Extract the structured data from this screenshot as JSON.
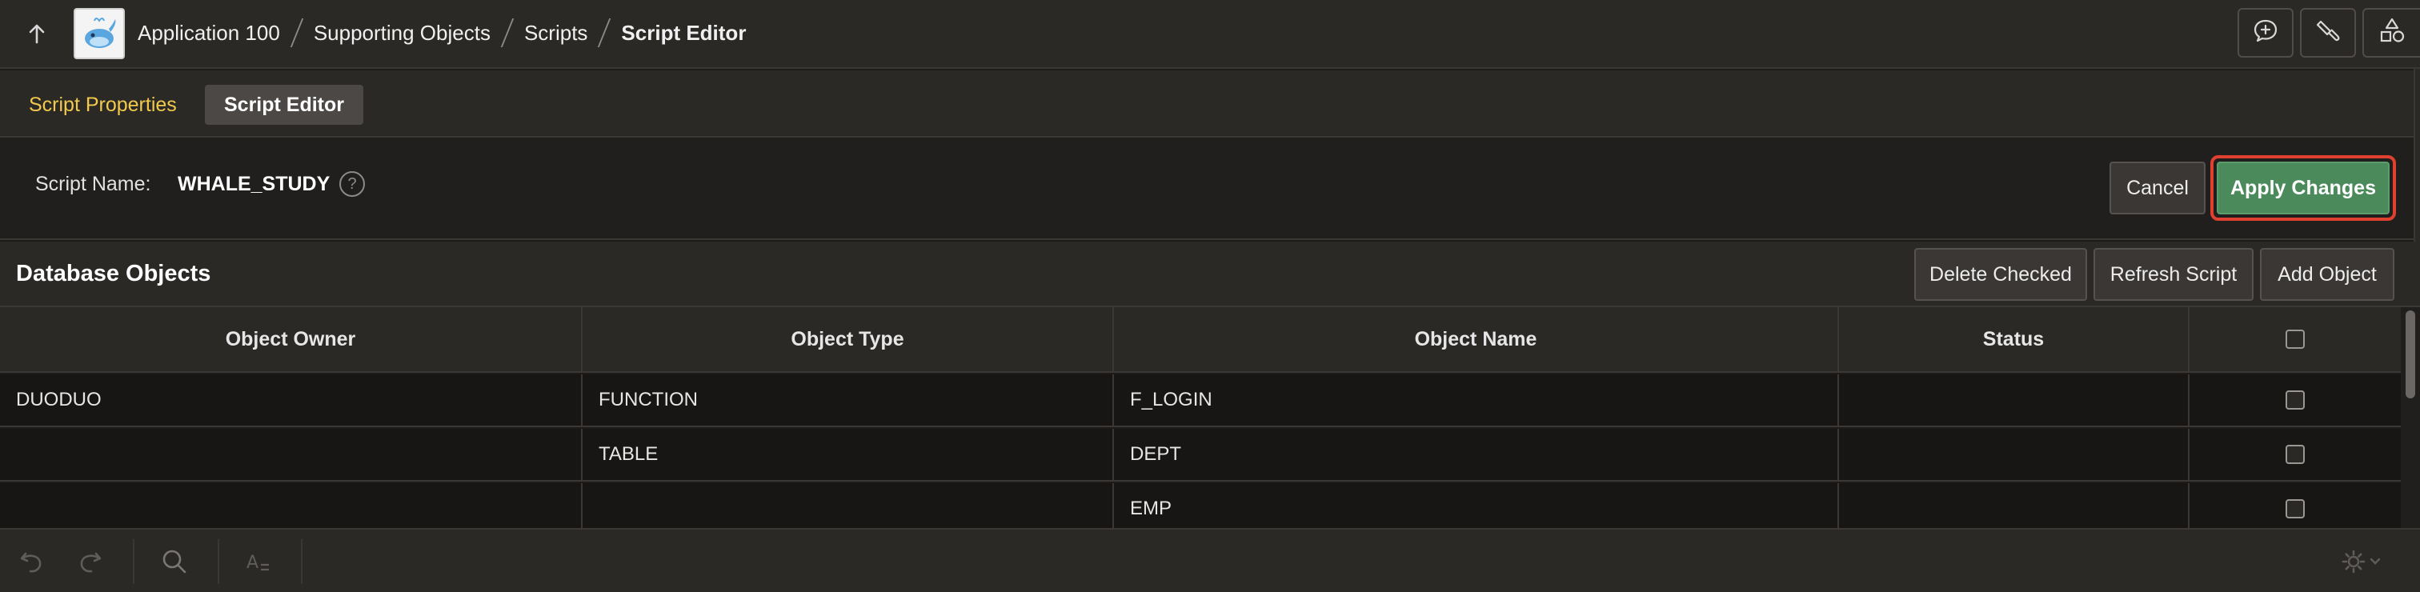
{
  "breadcrumb": {
    "items": [
      "Application 100",
      "Supporting Objects",
      "Scripts",
      "Script Editor"
    ]
  },
  "topbar": {
    "up_icon": "arrow-up-icon",
    "app_icon": "whale-app-icon",
    "right_icons": [
      "feedback-chat-icon",
      "brush-icon",
      "shapes-icon"
    ]
  },
  "tabs": {
    "properties": "Script Properties",
    "editor": "Script Editor",
    "active": "Script Editor"
  },
  "script": {
    "name_label": "Script Name:",
    "name_value": "WHALE_STUDY",
    "help": "?"
  },
  "actions": {
    "cancel": "Cancel",
    "apply": "Apply Changes"
  },
  "database_objects": {
    "title": "Database Objects",
    "delete_checked": "Delete Checked",
    "refresh_script": "Refresh Script",
    "add_object": "Add Object",
    "columns": [
      "Object Owner",
      "Object Type",
      "Object Name",
      "Status"
    ],
    "rows": [
      {
        "owner": "DUODUO",
        "type": "FUNCTION",
        "name": "F_LOGIN",
        "status": ""
      },
      {
        "owner": "",
        "type": "TABLE",
        "name": "DEPT",
        "status": ""
      },
      {
        "owner": "",
        "type": "",
        "name": "EMP",
        "status": ""
      }
    ]
  },
  "editor_toolbar": {
    "icons": [
      "undo-icon",
      "redo-icon",
      "search-icon",
      "autocomplete-icon",
      "settings-gear-icon"
    ]
  },
  "colors": {
    "accent_tab": "#f2c94c",
    "apply_button": "#4b8a5b",
    "highlight_outline": "#e0402f"
  }
}
